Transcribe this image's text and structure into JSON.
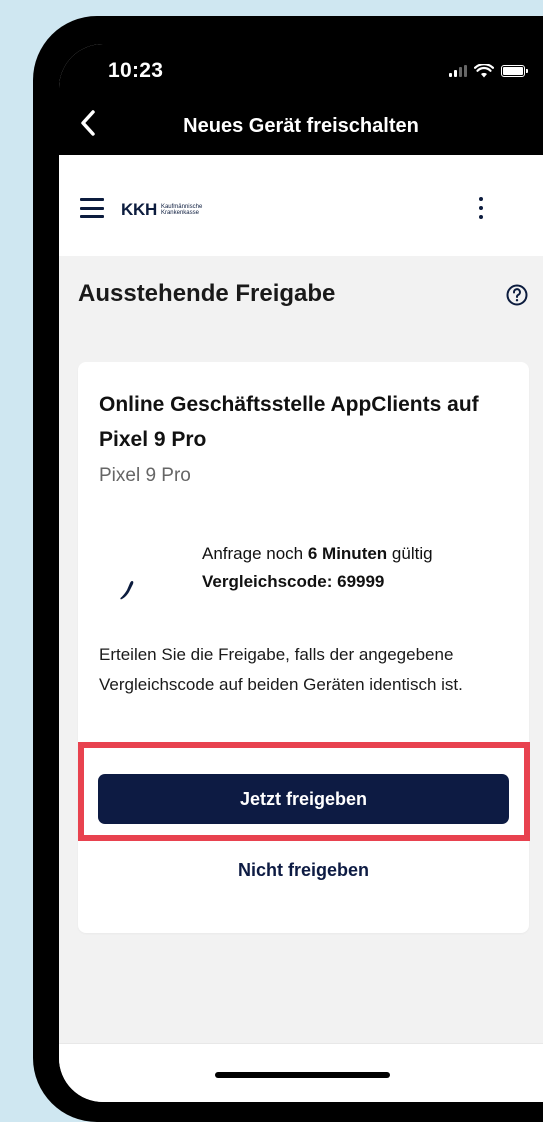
{
  "status_bar": {
    "time": "10:23",
    "icons": [
      "signal-icon",
      "wifi-icon",
      "battery-icon"
    ]
  },
  "nav": {
    "title": "Neues Gerät freischalten",
    "back_icon": "chevron-left-icon"
  },
  "app_header": {
    "menu_icon": "hamburger-menu-icon",
    "logo_main": "KKH",
    "logo_sub_line1": "Kaufmännische",
    "logo_sub_line2": "Krankenkasse",
    "more_icon": "more-vertical-icon"
  },
  "page": {
    "title": "Ausstehende Freigabe",
    "help_icon": "help-circle-icon"
  },
  "card": {
    "title": "Online Geschäftsstelle AppClients auf Pixel 9 Pro",
    "subtitle": "Pixel 9 Pro",
    "request_prefix": "Anfrage noch ",
    "request_time": "6 Minuten",
    "request_suffix": " gültig",
    "code_label": "Vergleichscode: 69999",
    "description": "Erteilen Sie die Freigabe, falls der angegebene Vergleichscode auf beiden Geräten identisch ist.",
    "primary_button": "Jetzt freigeben",
    "secondary_button": "Nicht freigeben"
  },
  "colors": {
    "primary": "#0d1b43",
    "highlight": "#e8424f",
    "background": "#cfe7f1"
  }
}
